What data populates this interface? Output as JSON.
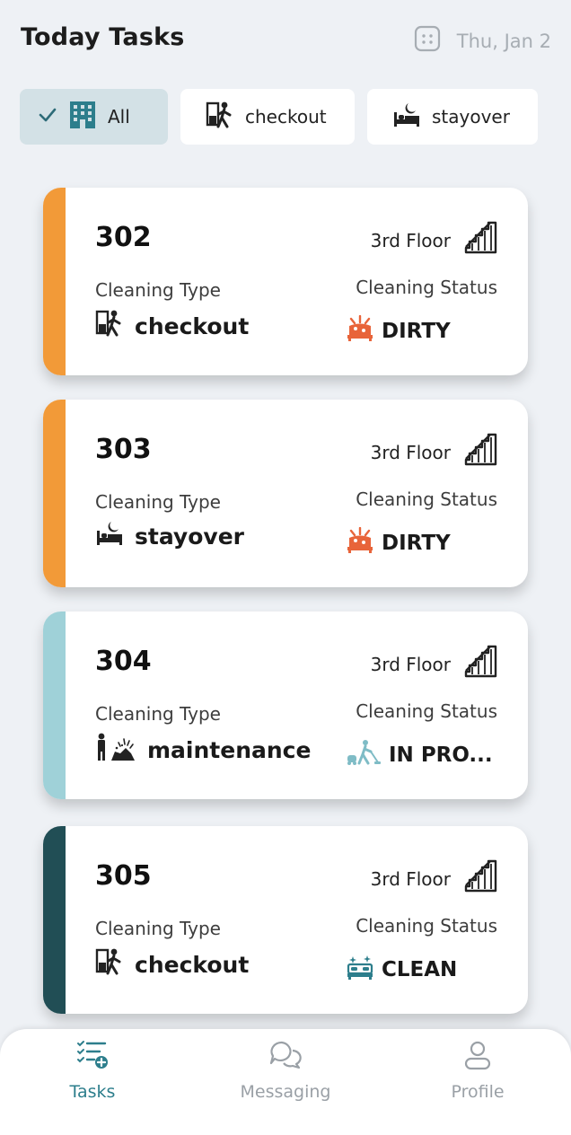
{
  "header": {
    "title": "Today Tasks",
    "date": "Thu, Jan 2",
    "calendar_icon": "calendar-icon"
  },
  "filters": [
    {
      "label": "All",
      "active": true,
      "icon": "building-icon"
    },
    {
      "label": "checkout",
      "active": false,
      "icon": "checkout-person-icon"
    },
    {
      "label": "stayover",
      "active": false,
      "icon": "bed-moon-icon"
    }
  ],
  "cards": [
    {
      "room": "302",
      "floor": "3rd Floor",
      "type_label": "Cleaning Type",
      "type": "checkout",
      "type_icon": "checkout-person-icon",
      "status_label": "Cleaning Status",
      "status": "DIRTY",
      "status_icon": "dirty-bed-icon",
      "stripe_color": "#f29a38"
    },
    {
      "room": "303",
      "floor": "3rd Floor",
      "type_label": "Cleaning Type",
      "type": "stayover",
      "type_icon": "bed-moon-icon",
      "status_label": "Cleaning Status",
      "status": "DIRTY",
      "status_icon": "dirty-bed-icon",
      "stripe_color": "#f29a38"
    },
    {
      "room": "304",
      "floor": "3rd Floor",
      "type_label": "Cleaning Type",
      "type": "maintenance",
      "type_icon": "maintenance-icon",
      "status_label": "Cleaning Status",
      "status": "IN PRO...",
      "status_icon": "vacuum-cleaner-icon",
      "stripe_color": "#9fd1d8"
    },
    {
      "room": "305",
      "floor": "3rd Floor",
      "type_label": "Cleaning Type",
      "type": "checkout",
      "type_icon": "checkout-person-icon",
      "status_label": "Cleaning Status",
      "status": "CLEAN",
      "status_icon": "clean-bed-icon",
      "stripe_color": "#214e55"
    }
  ],
  "nav": [
    {
      "label": "Tasks",
      "active": true,
      "icon": "tasks-icon"
    },
    {
      "label": "Messaging",
      "active": false,
      "icon": "chat-bubbles-icon"
    },
    {
      "label": "Profile",
      "active": false,
      "icon": "user-icon"
    }
  ],
  "colors": {
    "accent": "#2d7e8c",
    "dirty": "#e8643a",
    "in_progress": "#7fbcc6",
    "clean": "#2d7e8c"
  }
}
